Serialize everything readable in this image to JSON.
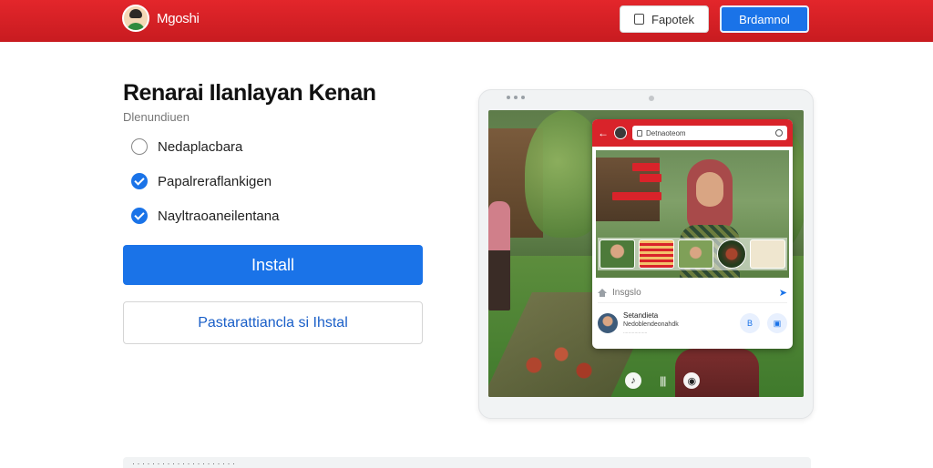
{
  "header": {
    "brand_name": "Mgoshi",
    "outline_button_label": "Fapotek",
    "primary_button_label": "Brdamnol"
  },
  "main": {
    "title": "Renarai Ilanlayan Kenan",
    "subtitle": "Dlenundiuen",
    "options": [
      {
        "label": "Nedaplacbara",
        "checked": false
      },
      {
        "label": "Papalreraflankigen",
        "checked": true
      },
      {
        "label": "Nayltraoaneilentana",
        "checked": true
      }
    ],
    "install_label": "Install",
    "alt_button_label": "Pastarattiancla si Ihstal"
  },
  "device": {
    "app": {
      "url_text": "Detnaoteom",
      "row1_text": "Insgslo",
      "row2_name": "Setandieta",
      "row2_sub": "Nedoblendeonahdk",
      "row2_meta": "...................",
      "row_btn1": "B",
      "row_btn2": "▣"
    }
  },
  "footer": {
    "strip_text": "· · · · · · · · · · · · · · · · · · · · ·"
  },
  "colors": {
    "header_red": "#d9232a",
    "accent_blue": "#1a73e8"
  }
}
